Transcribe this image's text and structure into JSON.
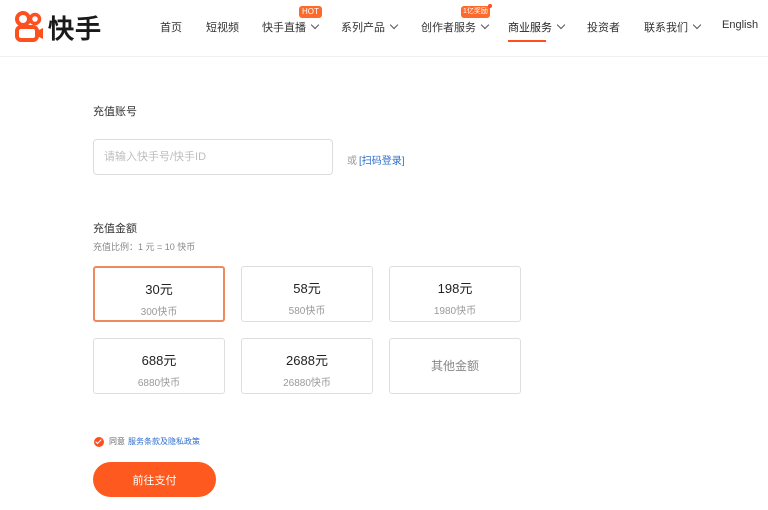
{
  "header": {
    "logo_text": "快手",
    "nav": [
      {
        "label": "首页"
      },
      {
        "label": "短视频"
      },
      {
        "label": "快手直播",
        "badge": "HOT"
      },
      {
        "label": "系列产品"
      },
      {
        "label": "创作者服务",
        "badge": "1亿奖励"
      },
      {
        "label": "商业服务"
      },
      {
        "label": "投资者"
      },
      {
        "label": "联系我们"
      },
      {
        "label": "English"
      }
    ]
  },
  "account": {
    "label": "充值账号",
    "placeholder": "请输入快手号/快手ID",
    "or": "或",
    "scan_link": "[扫码登录]"
  },
  "amount": {
    "label": "充值金额",
    "ratio": "充值比例：1 元 = 10 快币",
    "options": [
      {
        "price": "30元",
        "coins": "300快币"
      },
      {
        "price": "58元",
        "coins": "580快币"
      },
      {
        "price": "198元",
        "coins": "1980快币"
      },
      {
        "price": "688元",
        "coins": "6880快币"
      },
      {
        "price": "2688元",
        "coins": "26880快币"
      }
    ],
    "other": "其他金额"
  },
  "agreement": {
    "prefix": "同意",
    "link": "服务条款及隐私政策"
  },
  "pay_button": "前往支付",
  "colors": {
    "accent": "#fe4f1f",
    "selected_border": "#ee8a5c",
    "link": "#2c6ccc"
  }
}
